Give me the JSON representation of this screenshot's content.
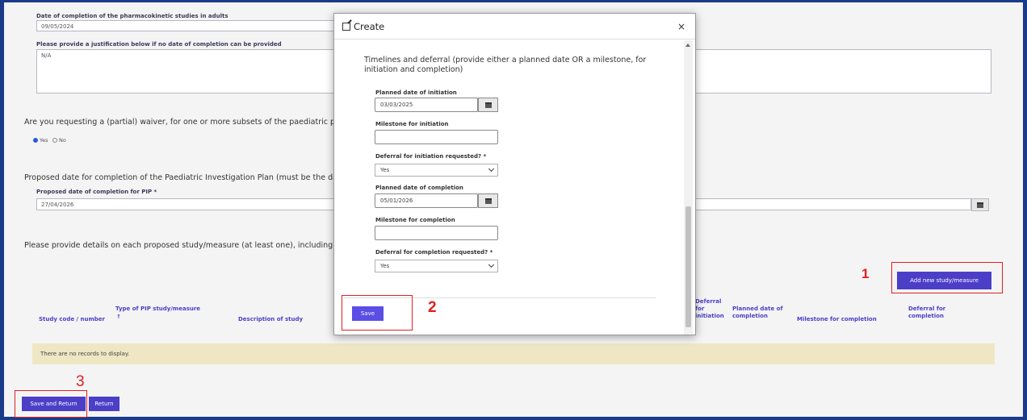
{
  "background": {
    "pk_date_label": "Date of completion of the pharmacokinetic studies in adults",
    "pk_date_value": "09/05/2024",
    "justification_label": "Please provide a justification below if no date of completion can be provided",
    "justification_value": "N/A",
    "waiver_question": "Are you requesting a (partial) waiver, for one or more subsets of the paediatric pop",
    "waiver_yes": "Yes",
    "waiver_no": "No",
    "proposed_date_question": "Proposed date for completion of the Paediatric Investigation Plan (must be the date",
    "proposed_date_label": "Proposed date of completion for PIP *",
    "proposed_date_value": "27/04/2026",
    "details_question": "Please provide details on each proposed study/measure (at least one), including ap",
    "add_button": "Add new study/measure",
    "table_headers": {
      "study_code": "Study code / number",
      "type": "Type of PIP study/measure",
      "sort_arrow": "↑",
      "description": "Description of study",
      "deferral_initiation_1": "Deferral",
      "deferral_initiation_2": "for",
      "deferral_initiation_3": "initiation",
      "planned_completion_1": "Planned date of",
      "planned_completion_2": "completion",
      "milestone_completion": "Milestone for completion",
      "deferral_completion_1": "Deferral for",
      "deferral_completion_2": "completion"
    },
    "no_records": "There are no records to display.",
    "save_and_return": "Save and Return",
    "return": "Return"
  },
  "modal": {
    "title": "Create",
    "close": "×",
    "intro": "Timelines and deferral (provide either a planned date OR a milestone, for initiation and completion)",
    "planned_initiation_label": "Planned date of initiation",
    "planned_initiation_value": "03/03/2025",
    "milestone_initiation_label": "Milestone for initiation",
    "deferral_initiation_label": "Deferral for initiation requested? *",
    "deferral_initiation_value": "Yes",
    "planned_completion_label": "Planned date of completion",
    "planned_completion_value": "05/01/2026",
    "milestone_completion_label": "Milestone for completion",
    "deferral_completion_label": "Deferral for completion requested? *",
    "deferral_completion_value": "Yes",
    "save": "Save"
  },
  "annotations": {
    "one": "1",
    "two": "2",
    "three": "3"
  },
  "colors": {
    "accent": "#4b3fc8",
    "highlight": "#e02020",
    "border_frame": "#1a3a8a",
    "no_records_bg": "#efe7c4"
  }
}
